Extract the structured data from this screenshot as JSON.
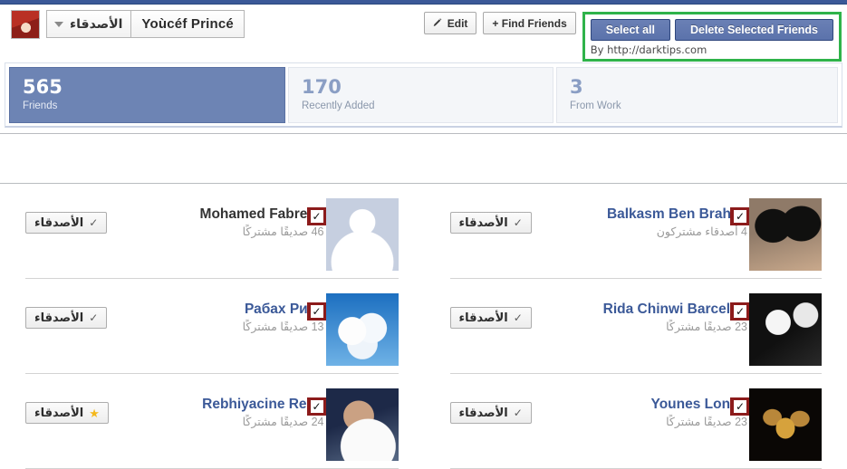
{
  "header": {
    "profile_dropdown_label": "الأصدقاء",
    "profile_name": "Yoùcéf Princé",
    "edit_label": "Edit",
    "find_friends_label": "+ Find Friends",
    "select_all_label": "Select all",
    "delete_selected_label": "Delete Selected Friends",
    "credit": "By http://darktips.com",
    "accent_green": "#2fb34a",
    "accent_blue": "#5b72ab"
  },
  "stats": [
    {
      "number": "565",
      "label": "Friends",
      "active": true
    },
    {
      "number": "170",
      "label": "Recently Added",
      "active": false
    },
    {
      "number": "3",
      "label": "From Work",
      "active": false
    }
  ],
  "friends": {
    "button_label": "الأصدقاء",
    "checkbox_color": "#8c1b1b",
    "items": [
      {
        "name": "Mohamed Fabrega",
        "mutual": "46 صديقًا مشتركًا",
        "checked": true,
        "action_icon": "check-icon",
        "photo": "silhouette",
        "name_color": "dark"
      },
      {
        "name": "Balkasm Ben Brahim",
        "mutual": "4 أصدقاء مشتركون",
        "checked": true,
        "action_icon": "check-icon",
        "photo": "sunglasses",
        "name_color": "blue"
      },
      {
        "name": "Рабах Рибх",
        "mutual": "13 صديقًا مشتركًا",
        "checked": true,
        "action_icon": "check-icon",
        "photo": "cloud",
        "name_color": "blue"
      },
      {
        "name": "Rida Chinwi Barcelon",
        "mutual": "23 صديقًا مشتركًا",
        "checked": true,
        "action_icon": "check-icon",
        "photo": "bw",
        "name_color": "blue"
      },
      {
        "name": "Rebhiyacine Rebh",
        "mutual": "24 صديقًا مشتركًا",
        "checked": true,
        "action_icon": "star-icon",
        "photo": "player",
        "name_color": "blue"
      },
      {
        "name": "Younes Londo",
        "mutual": "23 صديقًا مشتركًا",
        "checked": true,
        "action_icon": "check-icon",
        "photo": "calligraphy",
        "name_color": "blue"
      }
    ]
  }
}
